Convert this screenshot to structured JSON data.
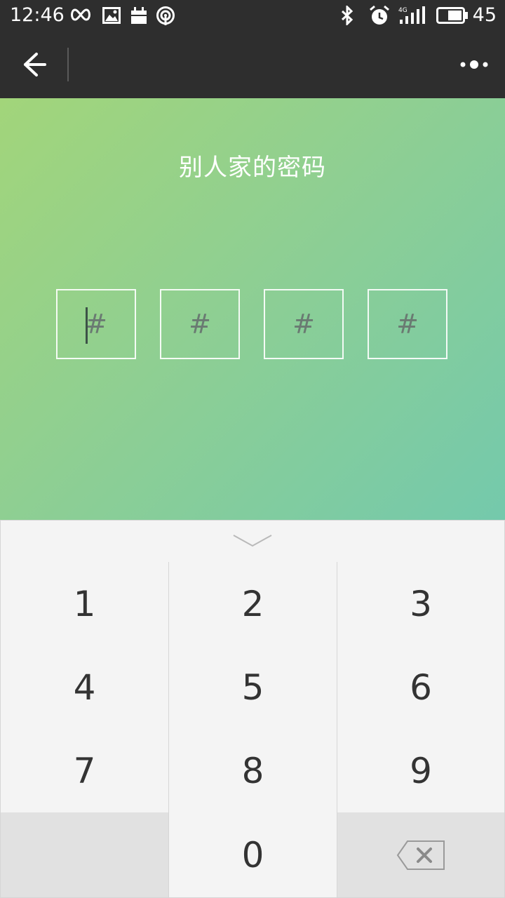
{
  "status_bar": {
    "time": "12:46",
    "battery": "45",
    "icons": [
      "infinity-icon",
      "image-icon",
      "calendar-icon",
      "hotspot-icon",
      "bluetooth-icon",
      "alarm-icon",
      "signal-4g-icon",
      "battery-icon"
    ]
  },
  "title_bar": {
    "back_icon": "arrow-left-icon",
    "more_icon": "more-dots-icon"
  },
  "hero": {
    "title": "别人家的密码",
    "boxes": [
      "#",
      "#",
      "#",
      "#"
    ],
    "colors": {
      "gradient_start": "#a2d57a",
      "gradient_end": "#74c9ac"
    }
  },
  "keypad": {
    "collapse_icon": "chevron-down-icon",
    "keys": [
      "1",
      "2",
      "3",
      "4",
      "5",
      "6",
      "7",
      "8",
      "9",
      "",
      "0",
      ""
    ],
    "backspace_icon": "backspace-icon"
  }
}
